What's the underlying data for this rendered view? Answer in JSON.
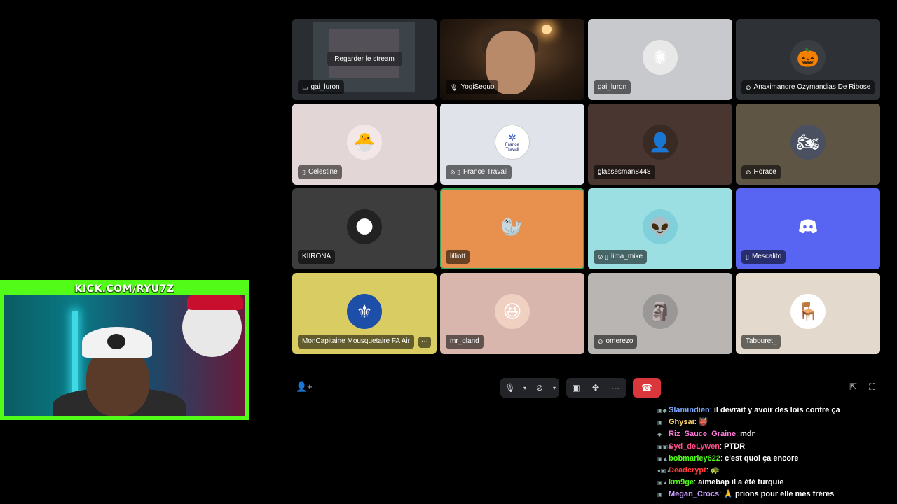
{
  "call": {
    "tiles": [
      {
        "name": "gai_luron",
        "icon": "screen-icon",
        "bg": "#2a2e33",
        "kind": "stream",
        "watch_label": "Regarder le stream"
      },
      {
        "name": "YogiSequo",
        "icon": "mic-icon",
        "bg": "#2b1d12",
        "kind": "camera"
      },
      {
        "name": "gai_luron",
        "icon": "",
        "bg": "#c7c9cc",
        "kind": "avatar",
        "avatar_color": "#e8e8e8",
        "avatar_glyph": "✺"
      },
      {
        "name": "Anaximandre Ozymandias De Ribose",
        "icon": "deafened-icon",
        "bg": "#2e3136",
        "kind": "avatar",
        "avatar_color": "#3a3d42",
        "avatar_glyph": "🎃"
      },
      {
        "name": "Celestine",
        "icon": "mobile-icon",
        "bg": "#e3d6d6",
        "kind": "avatar",
        "avatar_color": "#f3e7e7",
        "avatar_glyph": "🐣"
      },
      {
        "name": "France Travail",
        "icon": "muted-mobile-icon",
        "bg": "#e1e3ea",
        "kind": "avatar",
        "avatar_color": "#ffffff",
        "avatar_glyph": "France Travail"
      },
      {
        "name": "glassesman8448",
        "icon": "",
        "bg": "#4a3630",
        "kind": "avatar",
        "avatar_color": "#3a2a24",
        "avatar_glyph": "👤"
      },
      {
        "name": "Horace",
        "icon": "muted-icon",
        "bg": "#5f5545",
        "kind": "avatar",
        "avatar_color": "#4a5060",
        "avatar_glyph": "🏍"
      },
      {
        "name": "KIIRONA",
        "icon": "",
        "bg": "#3d3d3d",
        "kind": "avatar",
        "avatar_color": "#222",
        "avatar_glyph": "🌑"
      },
      {
        "name": "lilliott",
        "icon": "",
        "bg": "#e8914f",
        "kind": "avatar",
        "avatar_color": "#e8914f",
        "avatar_glyph": "🦭",
        "speaking": true
      },
      {
        "name": "lima_mike",
        "icon": "muted-mobile-icon",
        "bg": "#9bdfe3",
        "kind": "avatar",
        "avatar_color": "#7fd0da",
        "avatar_glyph": "👽"
      },
      {
        "name": "Mescalito",
        "icon": "mobile-icon",
        "bg": "#5865f2",
        "kind": "avatar",
        "avatar_color": "#5865f2",
        "avatar_glyph": "discord"
      },
      {
        "name": "MonCapitaine Mousquetaire FA Air",
        "icon": "",
        "bg": "#d9cc62",
        "kind": "avatar",
        "avatar_color": "#1e4fa8",
        "avatar_glyph": "⚜",
        "more": "···"
      },
      {
        "name": "mr_gland",
        "icon": "",
        "bg": "#d8b5ad",
        "kind": "avatar",
        "avatar_color": "#f0d0c0",
        "avatar_glyph": "😆"
      },
      {
        "name": "omerezo",
        "icon": "muted-icon",
        "bg": "#b8b5b3",
        "kind": "avatar",
        "avatar_color": "#9a9896",
        "avatar_glyph": "🗿"
      },
      {
        "name": "Tabouret_",
        "icon": "",
        "bg": "#e3d9cc",
        "kind": "avatar",
        "avatar_color": "#ffffff",
        "avatar_glyph": "🪑"
      }
    ]
  },
  "controls": {
    "invite_icon": "add-user-icon",
    "mic_icon": "mic-icon",
    "camera_icon": "camera-off-icon",
    "screen_icon": "screen-share-icon",
    "activity_icon": "activities-icon",
    "more_icon": "more-icon",
    "hangup_icon": "hangup-icon",
    "popout_icon": "popout-icon",
    "fullscreen_icon": "fullscreen-icon"
  },
  "stream": {
    "banner": "KICK.COM/RYU7Z",
    "banner_color": "#53fc18"
  },
  "chat": {
    "messages": [
      {
        "user": "Slamindien",
        "color": "#7da7ff",
        "text": "il devrait y avoir des lois contre ça",
        "badges": "▣◆"
      },
      {
        "user": "Ghysai",
        "color": "#ffd56a",
        "text": "👹",
        "badges": "▣"
      },
      {
        "user": "Riz_Sauce_Graine",
        "color": "#ff7ad9",
        "text": "mdr",
        "badges": "◆"
      },
      {
        "user": "Syd_deLywen",
        "color": "#ff4b8a",
        "text": "PTDR",
        "badges": "▣▣◆"
      },
      {
        "user": "bobmarley622",
        "color": "#53fc18",
        "text": "c'est quoi ça encore",
        "badges": "▣▲"
      },
      {
        "user": "Deadcrypt",
        "color": "#ff3b3b",
        "text": "🐢",
        "badges": "●▣▲"
      },
      {
        "user": "krn9ge",
        "color": "#53fc18",
        "text": "aimebap il a été turquie",
        "badges": "▣▲"
      },
      {
        "user": "Megan_Crocs",
        "color": "#c9a0ff",
        "text": "🙏 prions pour elle mes frères",
        "badges": "▣"
      }
    ]
  }
}
